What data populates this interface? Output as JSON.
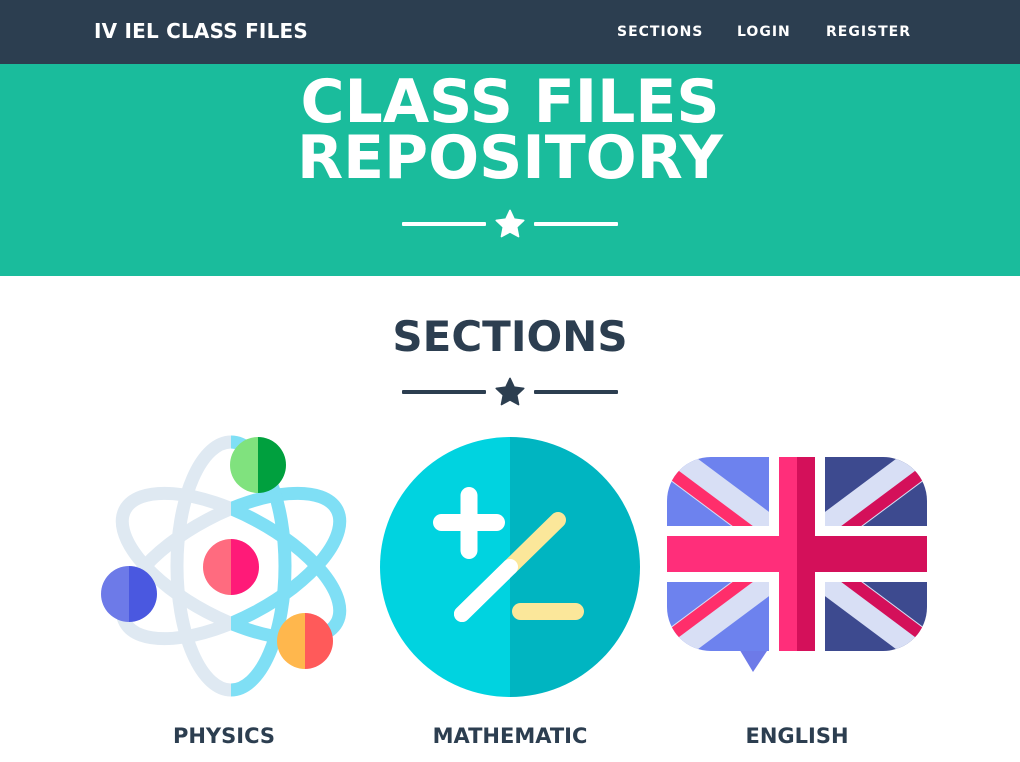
{
  "nav": {
    "brand": "IV IEL CLASS FILES",
    "links": [
      "SECTIONS",
      "LOGIN",
      "REGISTER"
    ]
  },
  "masthead": {
    "heading_line1": "CLASS FILES",
    "heading_line2": "REPOSITORY",
    "divider_icon": "star-icon"
  },
  "sections": {
    "heading": "SECTIONS",
    "divider_icon": "star-icon",
    "items": [
      {
        "label": "PHYSICS",
        "icon": "atom-icon"
      },
      {
        "label": "MATHEMATIC",
        "icon": "plus-minus-icon"
      },
      {
        "label": "ENGLISH",
        "icon": "uk-flag-speech-bubble-icon"
      }
    ]
  },
  "colors": {
    "navbar": "#2c3e50",
    "masthead": "#1abc9c",
    "text_dark": "#2c3e50",
    "white": "#ffffff"
  }
}
